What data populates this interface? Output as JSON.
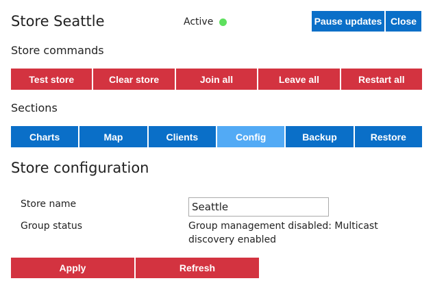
{
  "header": {
    "title": "Store Seattle",
    "status_label": "Active",
    "status_color": "#5ee05e",
    "pause_label": "Pause updates",
    "close_label": "Close"
  },
  "store_commands": {
    "heading": "Store commands",
    "buttons": [
      "Test store",
      "Clear store",
      "Join all",
      "Leave all",
      "Restart all"
    ]
  },
  "sections": {
    "heading": "Sections",
    "tabs": [
      "Charts",
      "Map",
      "Clients",
      "Config",
      "Backup",
      "Restore"
    ],
    "active_tab": "Config"
  },
  "configuration": {
    "heading": "Store configuration",
    "store_name_label": "Store name",
    "store_name_value": "Seattle",
    "group_status_label": "Group status",
    "group_status_value": "Group management disabled: Multicast discovery enabled",
    "apply_label": "Apply",
    "refresh_label": "Refresh"
  },
  "colors": {
    "primary_blue": "#0a6fc8",
    "active_tab_blue": "#52aaf5",
    "danger_red": "#d33340"
  }
}
